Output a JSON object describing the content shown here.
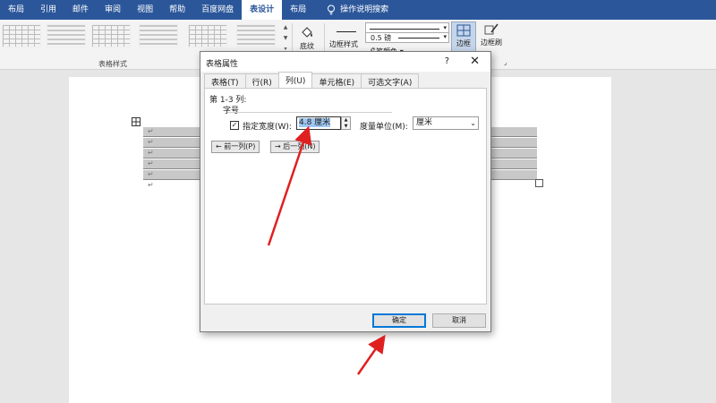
{
  "ribbon": {
    "tabs": [
      "布局",
      "引用",
      "邮件",
      "审阅",
      "视图",
      "帮助",
      "百度网盘",
      "表设计",
      "布局"
    ],
    "active_tab_index": 7,
    "search_label": "操作说明搜索",
    "style_group_label": "表格样式",
    "shading_label": "底纹",
    "border_styles_label": "边框样式",
    "pen_weight": "0.5 磅",
    "pen_color_label": "笔颜色",
    "borders_label": "边框",
    "border_painter_label": "边框刷"
  },
  "document": {
    "return_mark": "↵"
  },
  "dialog": {
    "title": "表格属性",
    "help": "?",
    "close": "✕",
    "tabs": [
      "表格(T)",
      "行(R)",
      "列(U)",
      "单元格(E)",
      "可选文字(A)"
    ],
    "active_tab_index": 2,
    "column_range": "第 1-3 列:",
    "size_label": "字号",
    "checkbox_mark": "✓",
    "width_label": "指定宽度(W):",
    "width_value": "4.8 厘米",
    "unit_label": "度量单位(M):",
    "unit_value": "厘米",
    "prev_column": "← 前一列(P)",
    "next_column": "→ 后一列(N)",
    "ok": "确定",
    "cancel": "取消"
  },
  "colors": {
    "ribbon_blue": "#2b579a",
    "arrow_red": "#e02020",
    "selection_blue": "#9ec6f3"
  }
}
